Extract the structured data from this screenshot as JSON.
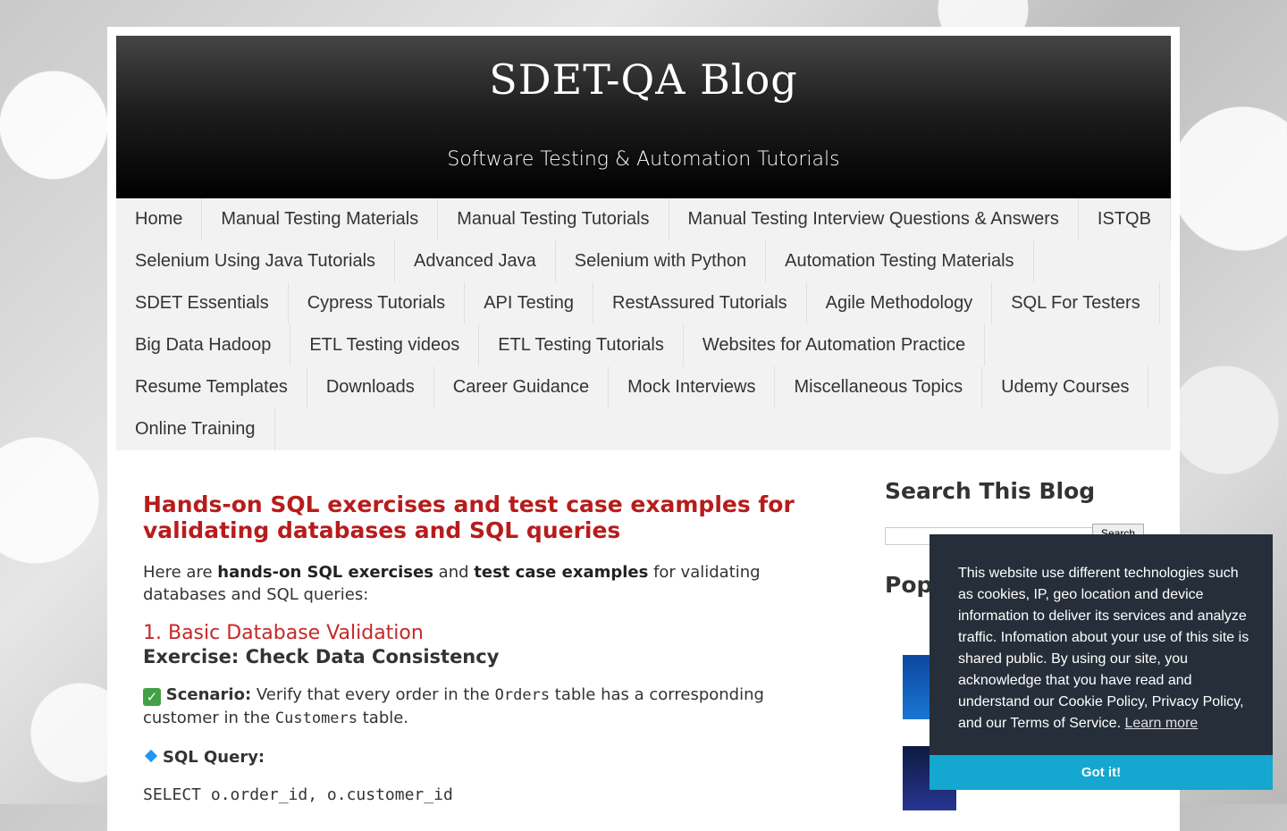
{
  "header": {
    "title": "SDET-QA Blog",
    "description": "Software Testing & Automation Tutorials"
  },
  "nav": {
    "rows": [
      [
        "Home",
        "Manual Testing Materials",
        "Manual Testing Tutorials",
        "Manual Testing Interview Questions & Answers",
        "ISTQB"
      ],
      [
        "Selenium Using Java Tutorials",
        "Advanced Java",
        "Selenium with Python",
        "Automation Testing Materials"
      ],
      [
        "SDET Essentials",
        "Cypress Tutorials",
        "API Testing",
        "RestAssured Tutorials",
        "Agile Methodology",
        "SQL For Testers"
      ],
      [
        "Big Data Hadoop",
        "ETL Testing videos",
        "ETL Testing Tutorials",
        "Websites for Automation Practice"
      ],
      [
        "Resume Templates",
        "Downloads",
        "Career Guidance",
        "Mock Interviews",
        "Miscellaneous Topics",
        "Udemy Courses"
      ],
      [
        "Online Training"
      ]
    ]
  },
  "post": {
    "title": "Hands-on SQL exercises and test case examples for validating databases and SQL queries",
    "intro_pre": " Here are ",
    "intro_b1": "hands-on SQL exercises",
    "intro_mid": " and ",
    "intro_b2": "test case examples",
    "intro_post": " for validating databases and SQL queries:",
    "section_heading": "1. Basic Database Validation",
    "exercise_heading": "Exercise: Check Data Consistency",
    "scenario_label": "Scenario:",
    "scenario_pre": " Verify that every order in the ",
    "scenario_code1": "Orders",
    "scenario_mid": " table has a corresponding customer in the ",
    "scenario_code2": "Customers",
    "scenario_post": " table.",
    "query_label": "SQL Query:",
    "code_line": "SELECT o.order_id, o.customer_id"
  },
  "sidebar": {
    "search_title": "Search This Blog",
    "search_button": "Search",
    "popular_title": "Pop"
  },
  "cookie": {
    "text": "This website use different technologies such as cookies, IP, geo location and device information to deliver its services and analyze traffic. Infomation about your use of this site is shared public. By using our site, you acknowledge that you have read and understand our Cookie Policy, Privacy Policy, and our Terms of Service.",
    "learn_more": "Learn more",
    "button": "Got it!"
  }
}
